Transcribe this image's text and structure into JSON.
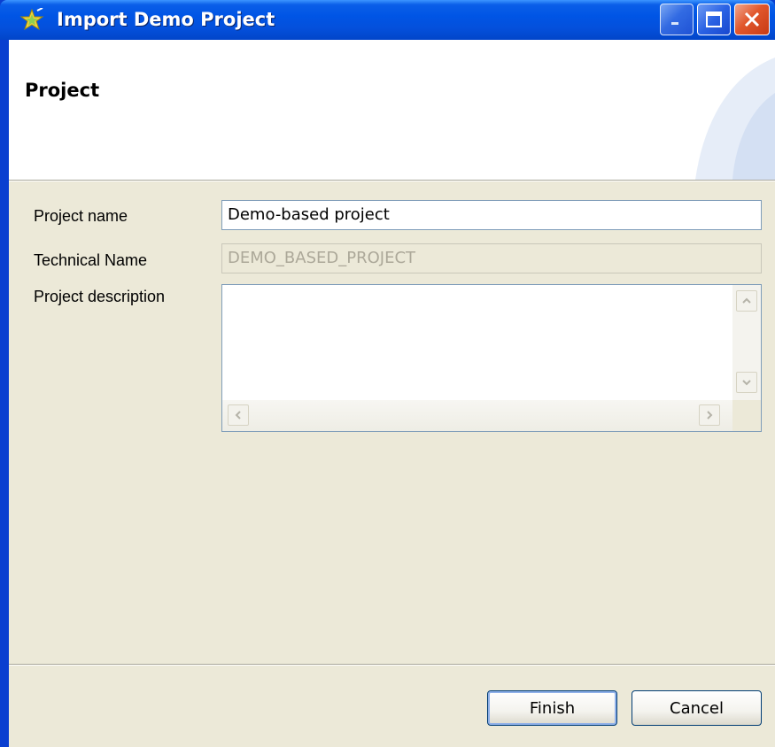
{
  "window": {
    "title": "Import Demo Project",
    "icon": "wizard-star-icon",
    "controls": [
      "minimize-icon",
      "maximize-icon",
      "close-icon"
    ]
  },
  "banner": {
    "title": "Project"
  },
  "form": {
    "project_name_label": "Project name",
    "project_name_value": "Demo-based project",
    "technical_name_label": "Technical Name",
    "technical_name_value": "DEMO_BASED_PROJECT",
    "description_label": "Project description",
    "description_value": ""
  },
  "buttons": {
    "finish": "Finish",
    "cancel": "Cancel"
  },
  "colors": {
    "titlebar": "#0055e5",
    "dialog_background": "#ece9d8",
    "close_button": "#e1572c"
  }
}
